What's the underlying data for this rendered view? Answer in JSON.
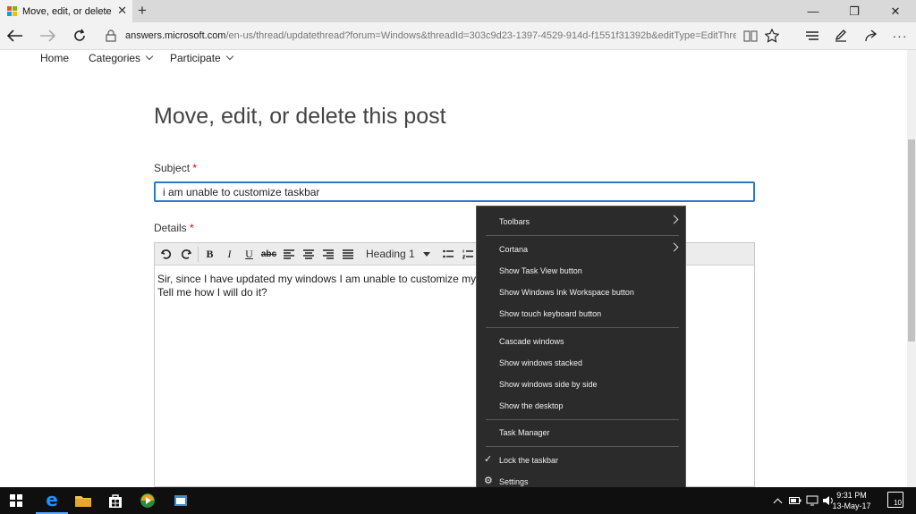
{
  "browser": {
    "tab_title": "Move, edit, or delete thi",
    "tab_close": "✕",
    "new_tab": "+",
    "window_controls": {
      "minimize": "—",
      "restore": "❐",
      "close": "✕"
    },
    "address_domain": "answers.microsoft.com",
    "address_path": "/en-us/thread/updatethread?forum=Windows&threadId=303c9d23-1397-4529-914d-f1551f31392b&editType=EditThreadByOwner&",
    "favicon_colors": [
      "#f25022",
      "#7fba00",
      "#00a4ef",
      "#ffb900"
    ]
  },
  "site_nav": {
    "items": [
      "Home",
      "Categories",
      "Participate"
    ]
  },
  "page": {
    "title": "Move, edit, or delete this post",
    "subject_label": "Subject",
    "subject_value": "i am unable to customize taskbar",
    "details_label": "Details",
    "required_marker": "*",
    "heading_select": "Heading 1",
    "body_line1": "Sir, since I have updated my windows I am unable to customize my taskb",
    "body_line2": "Tell me how I will do it?"
  },
  "context_menu": {
    "items": {
      "toolbars": "Toolbars",
      "cortana": "Cortana",
      "task_view": "Show Task View button",
      "ink_workspace": "Show Windows Ink Workspace button",
      "touch_keyboard": "Show touch keyboard button",
      "cascade": "Cascade windows",
      "stacked": "Show windows stacked",
      "side_by_side": "Show windows side by side",
      "desktop": "Show the desktop",
      "task_manager": "Task Manager",
      "lock_taskbar": "Lock the taskbar",
      "settings": "Settings"
    },
    "lock_checked": true
  },
  "taskbar": {
    "time": "9:31 PM",
    "date": "13-May-17",
    "notification_count": "10"
  },
  "colors": {
    "accent": "#2b78c5",
    "menu_bg": "#2b2b2b",
    "taskbar_bg": "#0f0f0f",
    "edge_blue": "#1e90ff"
  }
}
